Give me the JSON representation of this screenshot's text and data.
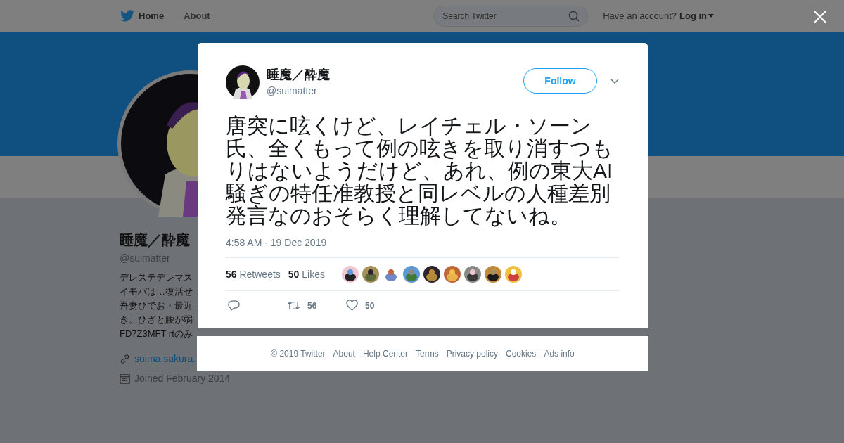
{
  "top_nav": {
    "items": [
      {
        "label": "Home",
        "selected": true
      },
      {
        "label": "About",
        "selected": false
      }
    ],
    "search": {
      "placeholder": "Search Twitter"
    },
    "account_prompt": "Have an account?",
    "login": "Log in"
  },
  "profile": {
    "name": "睡魔／酔魔",
    "handle": "@suimatter",
    "bio_lines": [
      "デレステデレマス",
      "イモバは…復活せ",
      "吾妻ひでお・最近",
      "き。ひざと腰が弱",
      "FD7Z3MFT rtのみ"
    ],
    "link": "suima.sakura.",
    "joined": "Joined February 2014"
  },
  "tweet": {
    "author": {
      "name": "睡魔／酔魔",
      "handle": "@suimatter"
    },
    "follow_button": "Follow",
    "text": "唐突に呟くけど、レイチェル・ソーン氏、全くもって例の呟きを取り消すつもりはないようだけど、あれ、例の東大AI騒ぎの特任准教授と同レベルの人種差別発言なのおそらく理解してないね。",
    "timestamp": "4:58 AM - 19 Dec 2019",
    "stats": [
      {
        "count": "56",
        "label": "Retweets"
      },
      {
        "count": "50",
        "label": "Likes"
      }
    ],
    "actions": [
      {
        "kind": "reply"
      },
      {
        "kind": "retweet",
        "count": "56"
      },
      {
        "kind": "like",
        "count": "50"
      }
    ]
  },
  "footer": [
    "© 2019 Twitter",
    "About",
    "Help Center",
    "Terms",
    "Privacy policy",
    "Cookies",
    "Ads info"
  ]
}
